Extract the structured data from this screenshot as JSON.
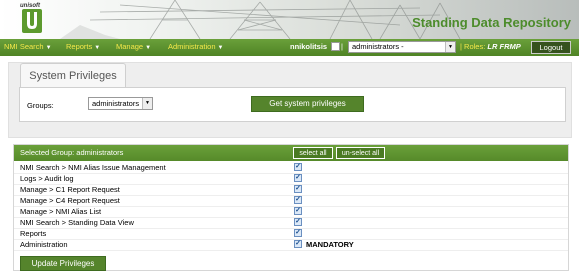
{
  "header": {
    "brand": "unisoft",
    "logo_letter": "U",
    "app_title": "Standing Data Repository"
  },
  "nav": {
    "items": [
      {
        "label": "NMI Search"
      },
      {
        "label": "Reports"
      },
      {
        "label": "Manage"
      },
      {
        "label": "Administration"
      }
    ],
    "username": "nnikolitsis",
    "separator": "|",
    "group_value": "administrators -",
    "roles_label": "Roles:",
    "roles_value": "LR FRMP",
    "logout_label": "Logout"
  },
  "page": {
    "tab_label": "System Privileges",
    "groups_label": "Groups:",
    "groups_value": "administrators",
    "get_button": "Get system privileges"
  },
  "privileges": {
    "header_title": "Selected Group: administrators",
    "select_all": "select all",
    "unselect_all": "un-select all",
    "rows": [
      {
        "name": "NMI Search > NMI Alias Issue Management",
        "checked": true
      },
      {
        "name": "Logs > Audit log",
        "checked": true
      },
      {
        "name": "Manage > C1 Report Request",
        "checked": true
      },
      {
        "name": "Manage > C4 Report Request",
        "checked": true
      },
      {
        "name": "Manage > NMI Alias List",
        "checked": true
      },
      {
        "name": "NMI Search > Standing Data View",
        "checked": true
      },
      {
        "name": "Reports",
        "checked": true
      },
      {
        "name": "Administration",
        "checked": true,
        "mandatory": "MANDATORY"
      }
    ],
    "update_button": "Update Privileges"
  },
  "colors": {
    "brand_green": "#4d8c2c",
    "nav_green": "#5d922f",
    "nav_yellow": "#f5e84a"
  }
}
